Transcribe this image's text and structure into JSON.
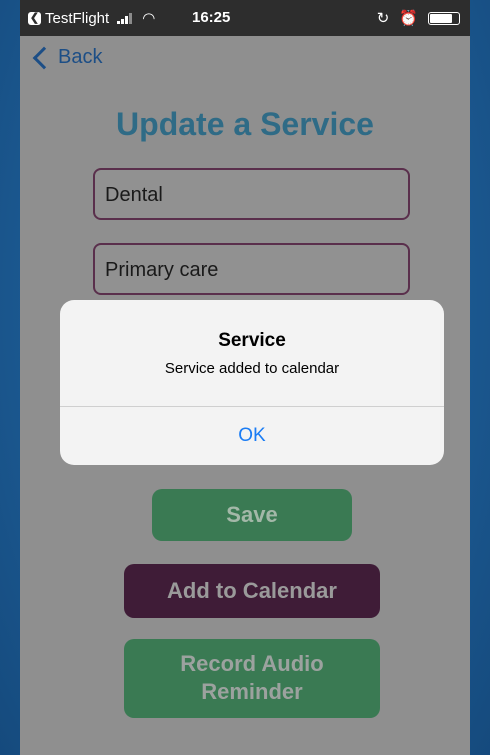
{
  "status_bar": {
    "app_name": "TestFlight",
    "time": "16:25"
  },
  "nav": {
    "back_label": "Back"
  },
  "page": {
    "title": "Update a Service",
    "service_type_value": "Dental",
    "service_name_value": "Primary care"
  },
  "buttons": {
    "save_label": "Save",
    "add_to_calendar_label": "Add to Calendar",
    "record_audio_label_line1": "Record Audio",
    "record_audio_label_line2": "Reminder"
  },
  "alert": {
    "title": "Service",
    "message": "Service added to calendar",
    "ok_label": "OK"
  },
  "colors": {
    "title": "#2f6b86",
    "save_button": "#3a7a53",
    "calendar_button": "#3f1c37",
    "alert_action": "#1a7cf4",
    "background": "#1e5f99"
  }
}
